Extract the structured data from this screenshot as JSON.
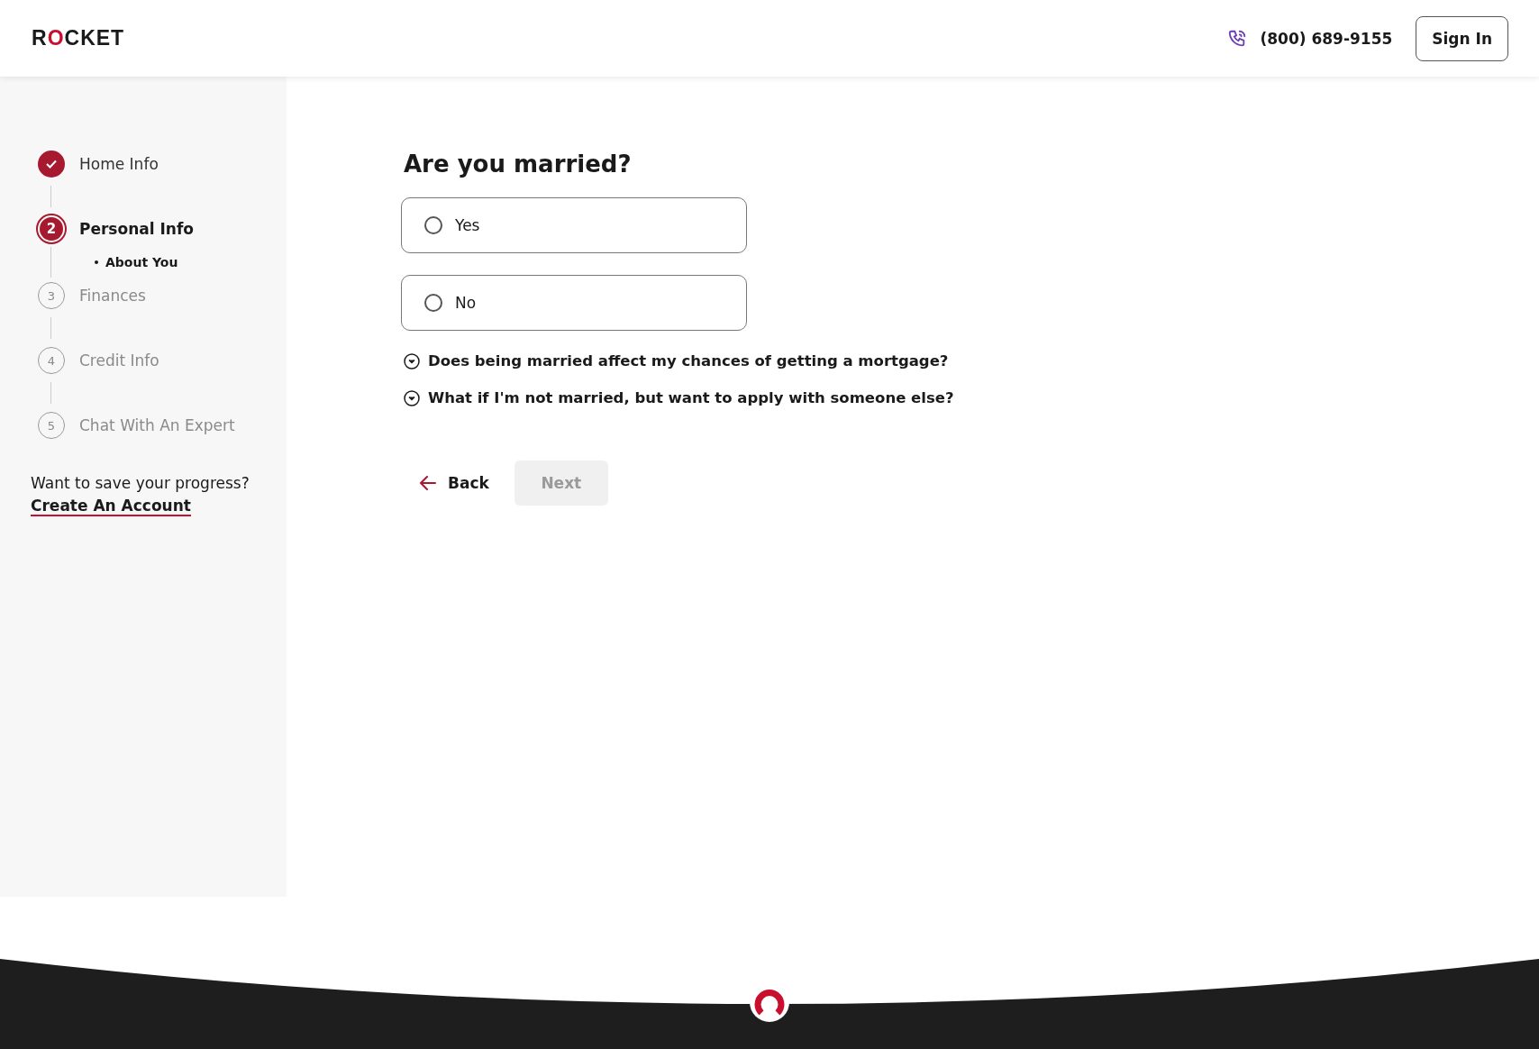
{
  "header": {
    "logo": "ROCKET",
    "phone": "(800) 689-9155",
    "sign_in": "Sign In"
  },
  "steps": [
    {
      "label": "Home Info",
      "completed": true,
      "selected": false
    },
    {
      "number": "2",
      "label": "Personal Info",
      "completed": false,
      "selected": true,
      "children": [
        {
          "label": "About You",
          "selected": true
        }
      ]
    },
    {
      "number": "3",
      "label": "Finances",
      "completed": false,
      "selected": false
    },
    {
      "number": "4",
      "label": "Credit Info",
      "completed": false,
      "selected": false
    },
    {
      "number": "5",
      "label": "Chat With An Expert",
      "completed": false,
      "selected": false
    }
  ],
  "save_prompt": {
    "text": "Want to save your progress?",
    "link": "Create An Account"
  },
  "question": {
    "title": "Are you married?",
    "options": [
      {
        "label": "Yes",
        "selected": false
      },
      {
        "label": "No",
        "selected": false
      }
    ],
    "faqs": [
      {
        "text": "Does being married affect my chances of getting a mortgage?",
        "expanded": false
      },
      {
        "text": "What if I'm not married, but want to apply with someone else?",
        "expanded": false
      }
    ]
  },
  "nav": {
    "back": "Back",
    "next": "Next",
    "next_disabled": true
  }
}
